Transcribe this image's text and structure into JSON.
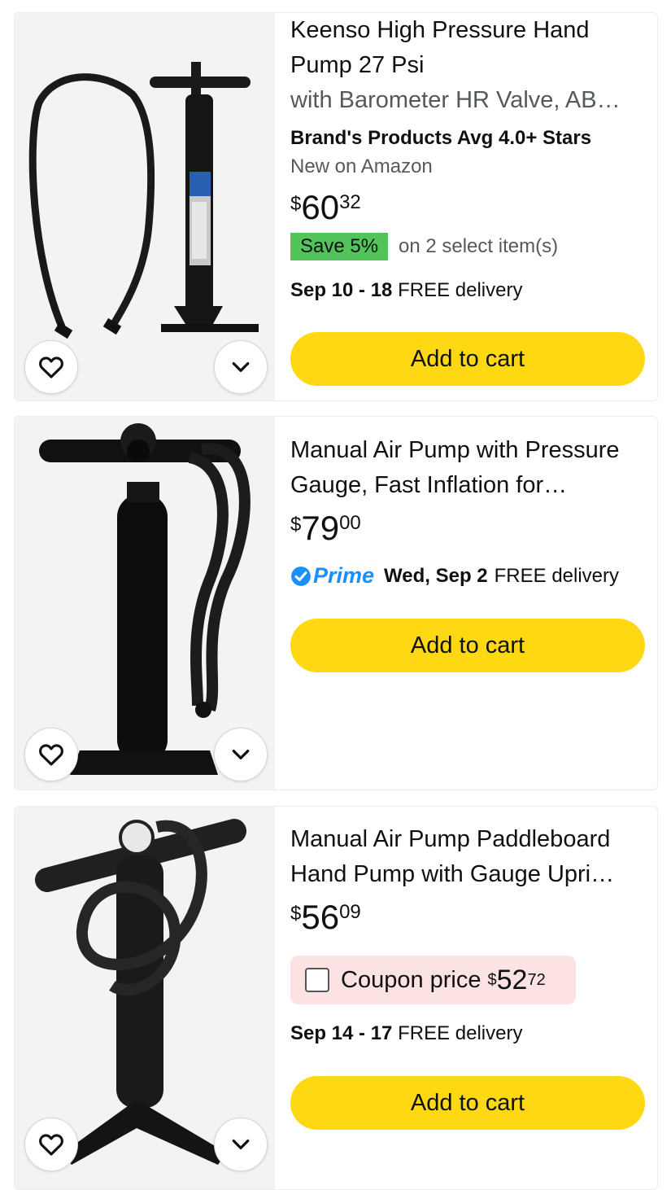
{
  "products": [
    {
      "title": "Keenso High Pressure Hand Pump 27 Psi",
      "subtitle": "with Barometer HR Valve, AB…",
      "brand_note": "Brand's Products Avg 4.0+ Stars",
      "new_note": "New on Amazon",
      "price": {
        "symbol": "$",
        "whole": "60",
        "fraction": "32"
      },
      "save_badge": "Save 5%",
      "save_note": "on 2 select item(s)",
      "delivery_date": "Sep 10 - 18",
      "delivery_text": "FREE delivery",
      "cart_label": "Add to cart"
    },
    {
      "title": "Manual Air Pump with Pressure Gauge, Fast Inflation for…",
      "price": {
        "symbol": "$",
        "whole": "79",
        "fraction": "00"
      },
      "prime_label": "Prime",
      "delivery_date": "Wed, Sep 2",
      "delivery_text": "FREE delivery",
      "cart_label": "Add to cart"
    },
    {
      "title": "Manual Air Pump Paddleboard Hand Pump with Gauge Upri…",
      "price": {
        "symbol": "$",
        "whole": "56",
        "fraction": "09"
      },
      "coupon": {
        "label": "Coupon price",
        "symbol": "$",
        "whole": "52",
        "fraction": "72"
      },
      "delivery_date": "Sep 14 - 17",
      "delivery_text": "FREE delivery",
      "cart_label": "Add to cart"
    }
  ],
  "colors": {
    "cart": "#ffd814",
    "save_badge": "#53c35c",
    "prime": "#1a8fff",
    "coupon_bg": "#fce2e2"
  },
  "icons": {
    "wishlist": "heart-icon",
    "more": "chevron-down-icon",
    "prime": "prime-check-icon"
  }
}
